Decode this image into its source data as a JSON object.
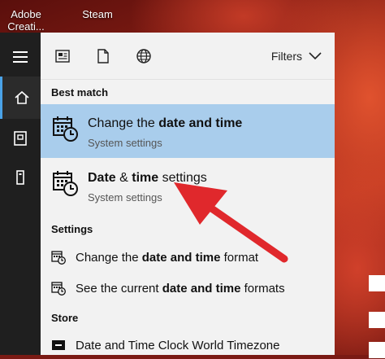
{
  "desktop": {
    "icons": [
      {
        "label_line1": "Adobe",
        "label_line2": "Creati..."
      },
      {
        "label_line1": "Steam",
        "label_line2": ""
      }
    ]
  },
  "toolbar": {
    "filters_label": "Filters"
  },
  "sections": {
    "best_match": "Best match",
    "settings": "Settings",
    "store": "Store"
  },
  "best_match": [
    {
      "title_pre": "Change the ",
      "title_bold": "date and time",
      "title_post": "",
      "subtitle": "System settings",
      "selected": true
    },
    {
      "title_pre": "",
      "title_bold": "Date",
      "title_mid": " & ",
      "title_bold2": "time",
      "title_post": " settings",
      "subtitle": "System settings",
      "selected": false
    }
  ],
  "settings": [
    {
      "pre": "Change the ",
      "bold": "date and time",
      "post": " format"
    },
    {
      "pre": "See the current ",
      "bold": "date and time",
      "post": " formats"
    }
  ],
  "store": [
    {
      "label": "Date and Time Clock World Timezone"
    }
  ],
  "colors": {
    "selected_bg": "#a9cdec",
    "panel_bg": "#f2f2f2",
    "rail_bg": "#1f1f1f",
    "accent": "#4aa3e8",
    "annotation_arrow": "#e0282c"
  },
  "icons": [
    "hamburger-icon",
    "home-icon",
    "document-icon",
    "tower-icon",
    "newspaper-icon",
    "globe-icon",
    "chevron-down-icon",
    "calendar-clock-icon",
    "store-app-icon"
  ]
}
